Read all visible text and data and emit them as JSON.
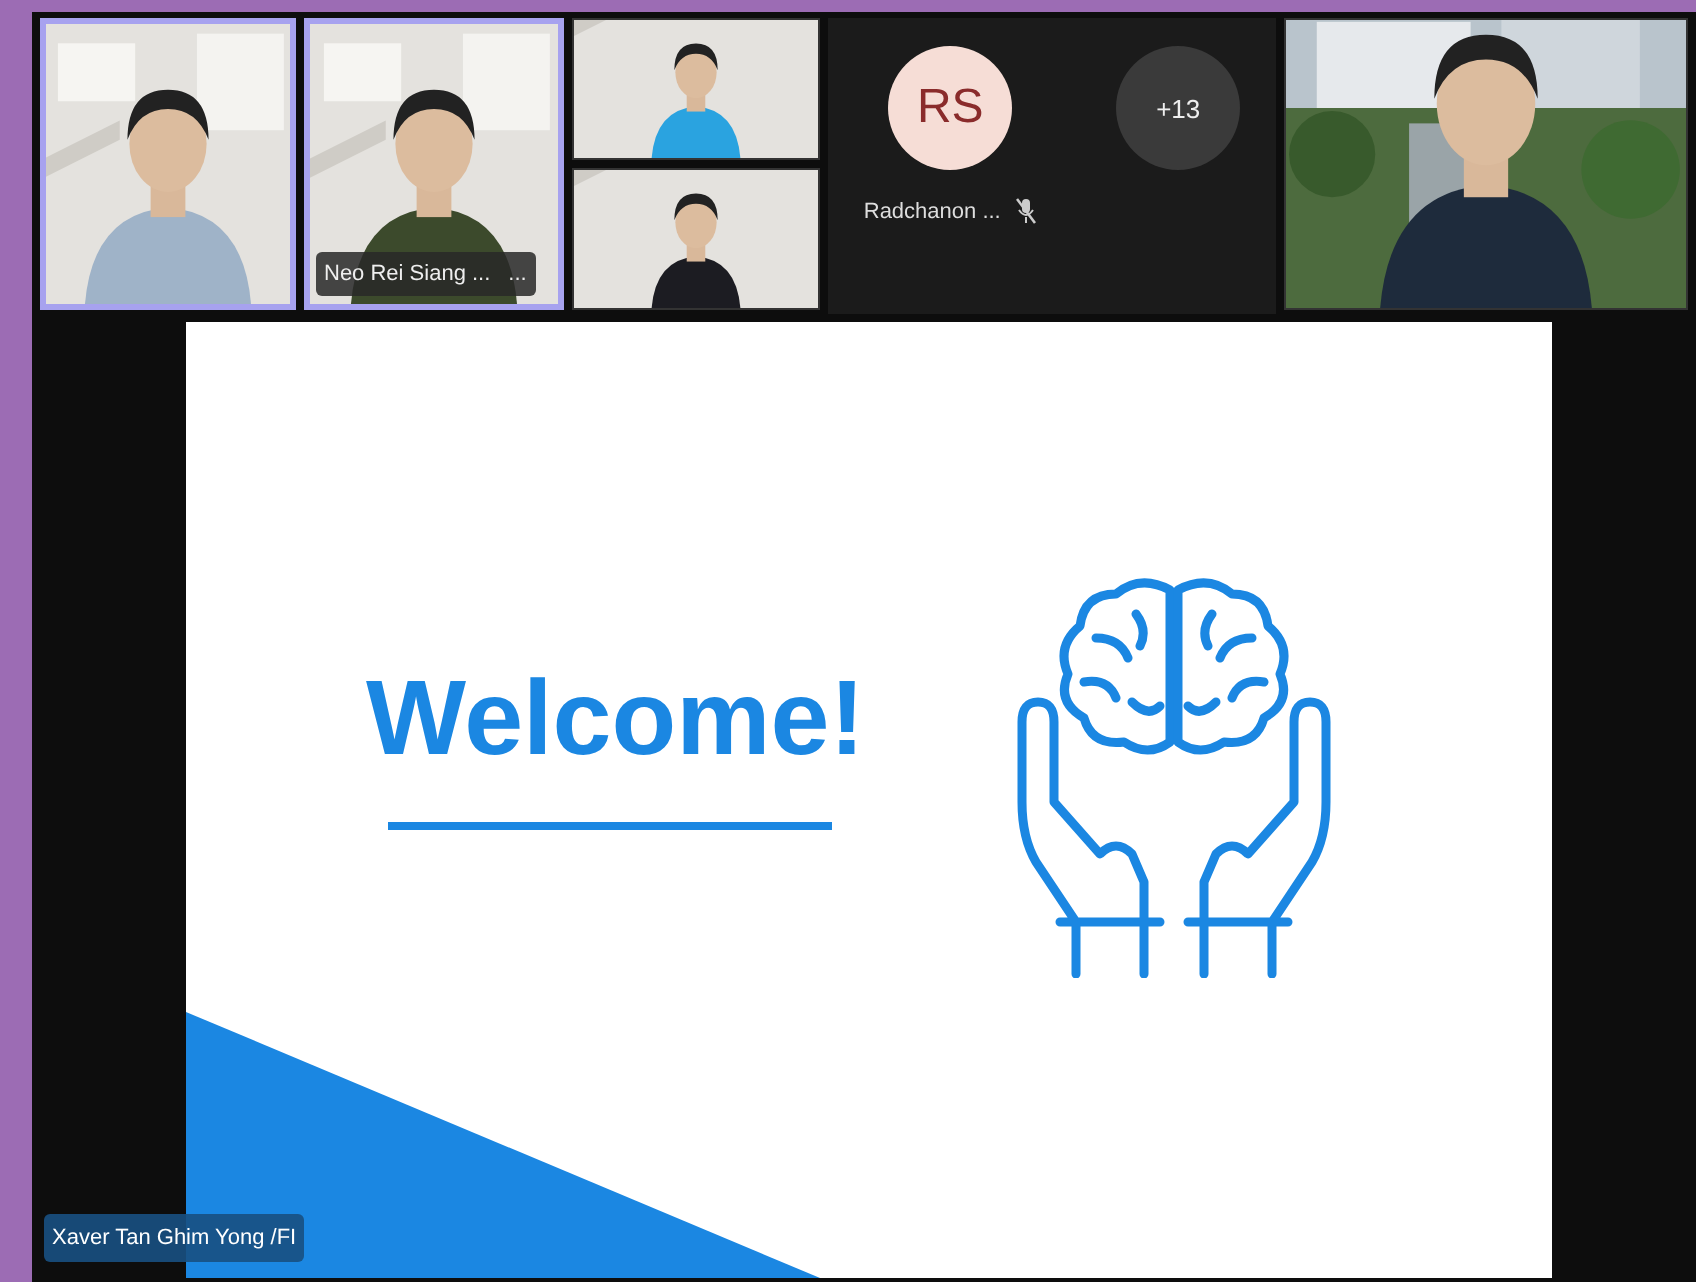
{
  "gallery": [
    {
      "tiles": [
        {
          "kind": "video",
          "highlighted": true
        }
      ]
    },
    {
      "tiles": [
        {
          "kind": "video",
          "highlighted": true,
          "name": "Neo Rei Siang ...",
          "more_button": "..."
        }
      ]
    },
    {
      "tiles": [
        {
          "kind": "video",
          "highlighted": false
        },
        {
          "kind": "video",
          "highlighted": false
        }
      ]
    },
    {
      "tiles": [
        {
          "kind": "avatar",
          "initials": "RS",
          "name": "Radchanon ...",
          "muted": true
        },
        {
          "kind": "overflow",
          "count": "+13"
        }
      ]
    },
    {
      "tiles": [
        {
          "kind": "video",
          "highlighted": false
        }
      ]
    }
  ],
  "shared_screen": {
    "slide": {
      "title": "Welcome!"
    },
    "presenter": "Xaver Tan Ghim Yong /FI"
  }
}
